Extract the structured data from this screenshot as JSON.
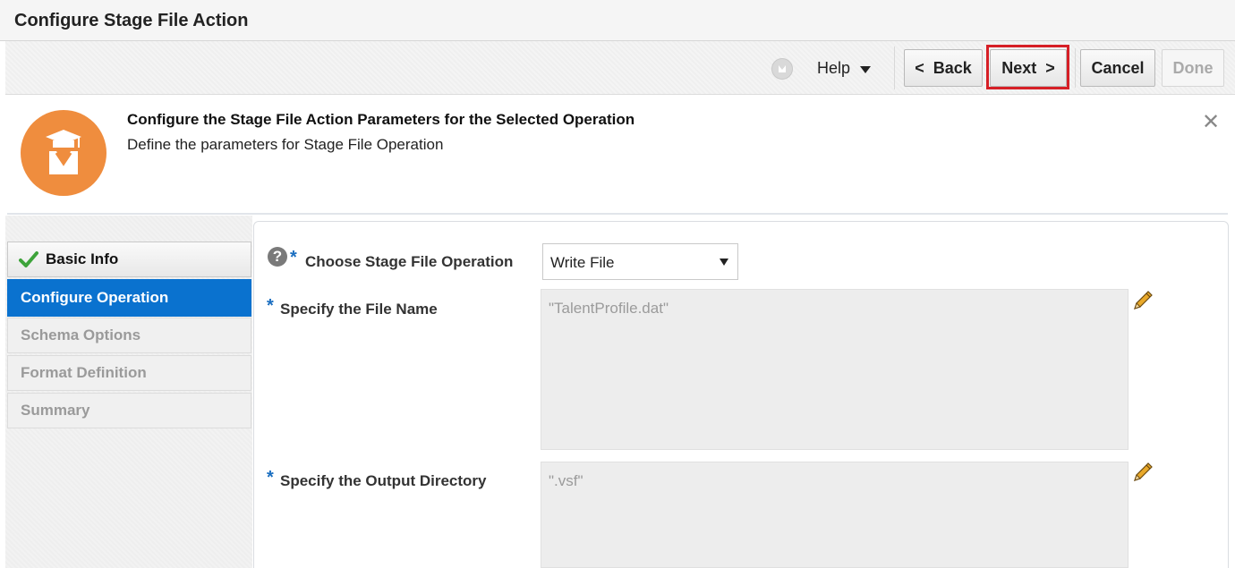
{
  "window": {
    "title": "Configure Stage File Action"
  },
  "toolbar": {
    "help_label": "Help",
    "back_label": "<  Back",
    "next_label": "Next  >",
    "cancel_label": "Cancel",
    "done_label": "Done"
  },
  "info": {
    "title": "Configure the Stage File Action Parameters for the Selected Operation",
    "subtitle": "Define the parameters for Stage File Operation",
    "badge_color": "#ef8d3e",
    "badge_icon": "graduate-icon",
    "close_icon": "close-icon"
  },
  "nav": {
    "items": [
      {
        "label": "Basic Info",
        "state": "completed"
      },
      {
        "label": "Configure Operation",
        "state": "active"
      },
      {
        "label": "Schema Options",
        "state": "disabled"
      },
      {
        "label": "Format Definition",
        "state": "disabled"
      },
      {
        "label": "Summary",
        "state": "disabled"
      }
    ],
    "active_color": "#0a72cf"
  },
  "form": {
    "required_marker": "*",
    "help_glyph": "?",
    "operation_label": "Choose Stage File Operation",
    "operation_value": "Write File",
    "file_name_label": "Specify the File Name",
    "file_name_value": "\"TalentProfile.dat\"",
    "output_dir_label": "Specify the Output Directory",
    "output_dir_value": "\".vsf\""
  },
  "colors": {
    "highlight_outline": "#d61f26"
  }
}
